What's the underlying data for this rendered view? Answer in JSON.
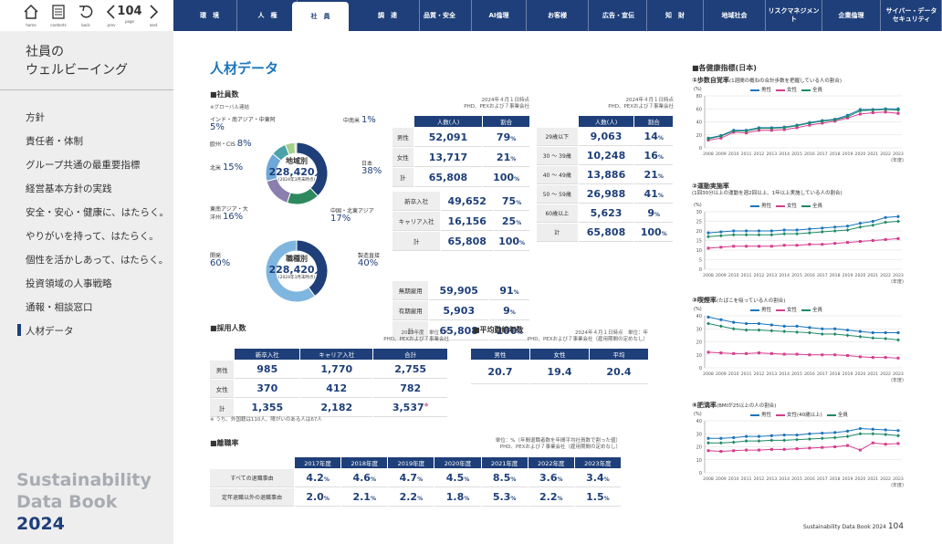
{
  "toolbar": {
    "home": "home",
    "contents": "contents",
    "back": "back",
    "prev": "prev",
    "page": "page",
    "next": "next",
    "page_number": "104"
  },
  "nav_tabs": [
    "環　境",
    "人　権",
    "社　員",
    "調　達",
    "品質・安全",
    "AI倫理",
    "お客様",
    "広告・宣伝",
    "知　財",
    "地域社会",
    "リスクマネジメント",
    "企業倫理",
    "サイバー・データ\nセキュリティ"
  ],
  "sidebar": {
    "title_line1": "社員の",
    "title_line2": "ウェルビーイング",
    "items": [
      "方針",
      "責任者・体制",
      "グループ共通の最重要指標",
      "経営基本方針の実践",
      "安全・安心・健康に、はたらく。",
      "やりがいを持って、はたらく。",
      "個性を活かしあって、はたらく。",
      "投資領域の人事戦略",
      "通報・相談窓口",
      "人材データ"
    ],
    "brand1": "Sustainability",
    "brand2": "Data Book",
    "brand3": "2024"
  },
  "colors": {
    "accent": "#1e3f79",
    "male": "#1a75bc",
    "female": "#d63c8e",
    "all": "#1f8a66"
  },
  "main": {
    "title": "人材データ",
    "employees": {
      "heading": "■社員数",
      "group_note": "※グローバル連結",
      "donut1": {
        "title": "地域別",
        "total": "228,420人",
        "sub": "(2024年3月末時点)",
        "labels": [
          {
            "name": "インド・南アジア・中東阿",
            "pct": "5%"
          },
          {
            "name": "欧州・CIS",
            "pct": "8%"
          },
          {
            "name": "北米",
            "pct": "15%"
          },
          {
            "name": "東南アジア・大洋州",
            "pct": "16%"
          },
          {
            "name": "中南米",
            "pct": "1%"
          },
          {
            "name": "日本",
            "pct": "38%"
          },
          {
            "name": "中国・北東アジア",
            "pct": "17%"
          }
        ]
      },
      "donut2": {
        "title": "職種別",
        "total": "228,420人",
        "sub": "(2024年3月末時点)",
        "labels": [
          {
            "name": "開発",
            "pct": "60%"
          },
          {
            "name": "製造直接",
            "pct": "40%"
          }
        ]
      },
      "note1a": "2024年４月１日時点",
      "note1b": "PHD、PEXおよび７事業会社",
      "note2a": "2024年４月１日時点",
      "note2b": "PHD、PEXおよび７事業会社",
      "gender_table": {
        "headers": [
          "人数(人)",
          "割合"
        ],
        "rows": [
          [
            "男性",
            "52,091",
            "79%"
          ],
          [
            "女性",
            "13,717",
            "21%"
          ],
          [
            "計",
            "65,808",
            "100%"
          ]
        ]
      },
      "hire_table": {
        "rows": [
          [
            "新卒入社",
            "49,652",
            "75%"
          ],
          [
            "キャリア入社",
            "16,156",
            "25%"
          ],
          [
            "計",
            "65,808",
            "100%"
          ]
        ]
      },
      "contract_table": {
        "rows": [
          [
            "無期雇用",
            "59,905",
            "91%"
          ],
          [
            "有期雇用",
            "5,903",
            "9%"
          ],
          [
            "計",
            "65,808",
            "100%"
          ]
        ]
      },
      "age_table": {
        "headers": [
          "人数(人)",
          "割合"
        ],
        "rows": [
          [
            "29歳以下",
            "9,063",
            "14%"
          ],
          [
            "30 ～ 39歳",
            "10,248",
            "16%"
          ],
          [
            "40 ～ 49歳",
            "13,886",
            "21%"
          ],
          [
            "50 ～ 59歳",
            "26,988",
            "41%"
          ],
          [
            "60歳以上",
            "5,623",
            "9%"
          ],
          [
            "計",
            "65,808",
            "100%"
          ]
        ]
      }
    },
    "recruit": {
      "heading": "■採用人数",
      "note_a": "2023年度　単位：人",
      "note_b": "PHD、PEXおよび７事業会社",
      "headers": [
        "新卒入社",
        "キャリア入社",
        "合計"
      ],
      "rows": [
        [
          "男性",
          "985",
          "1,770",
          "2,755"
        ],
        [
          "女性",
          "370",
          "412",
          "782"
        ],
        [
          "計",
          "1,355",
          "2,182",
          "3,537"
        ]
      ],
      "mark": "※",
      "footnote": "※ うち、外国籍は110人、障がいのある人は67人"
    },
    "tenure": {
      "heading": "■平均勤続年数",
      "note_a": "2024年４月１日時点　単位：年",
      "note_b": "PHD、PEXおよび７事業会社（雇用期間の定めなし）",
      "headers": [
        "男性",
        "女性",
        "平均"
      ],
      "values": [
        "20.7",
        "19.4",
        "20.4"
      ]
    },
    "turnover": {
      "heading": "■離職率",
      "note_a": "単位：%（年間退職者数を年間平均社員数で割った値）",
      "note_b": "PHD、PEXおよび７事業会社（雇用期間の定めなし）",
      "headers": [
        "2017年度",
        "2018年度",
        "2019年度",
        "2020年度",
        "2021年度",
        "2022年度",
        "2023年度"
      ],
      "rows": [
        {
          "label": "すべての退職事由",
          "values": [
            "4.2%",
            "4.6%",
            "4.7%",
            "4.5%",
            "8.5%",
            "3.6%",
            "3.4%"
          ]
        },
        {
          "label": "定年退職以外の退職事由",
          "values": [
            "2.0%",
            "2.1%",
            "2.2%",
            "1.8%",
            "5.3%",
            "2.2%",
            "1.5%"
          ]
        }
      ]
    }
  },
  "chart_data": [
    {
      "type": "line",
      "title": "①歩数自覚率",
      "subtitle": "(1週間の概ねの合計歩数を把握している人の割合)",
      "ylabel": "(%)",
      "xlabel": "(年度)",
      "ylim": [
        0,
        80
      ],
      "yticks": [
        0,
        20,
        40,
        60,
        80
      ],
      "x": [
        "2008",
        "2009",
        "2010",
        "2011",
        "2012",
        "2013",
        "2014",
        "2015",
        "2016",
        "2017",
        "2018",
        "2019",
        "2020",
        "2021",
        "2022",
        "2023"
      ],
      "series": [
        {
          "name": "男性",
          "values": [
            15,
            19,
            27,
            27,
            31,
            31,
            32,
            35,
            39,
            42,
            44,
            50,
            59,
            59,
            60,
            60
          ]
        },
        {
          "name": "女性",
          "values": [
            12,
            15,
            24,
            23,
            27,
            27,
            28,
            31,
            35,
            38,
            41,
            46,
            52,
            54,
            55,
            53
          ]
        },
        {
          "name": "全員",
          "values": [
            14,
            18,
            26,
            26,
            30,
            30,
            31,
            34,
            38,
            41,
            43,
            48,
            57,
            58,
            59,
            58
          ]
        }
      ]
    },
    {
      "type": "line",
      "title": "②運動実施率",
      "subtitle": "(1回30分以上の運動を週2回以上、1年以上実施している人の割合)",
      "ylabel": "(%)",
      "xlabel": "(年度)",
      "ylim": [
        0,
        30
      ],
      "yticks": [
        0,
        5,
        10,
        15,
        20,
        25,
        30
      ],
      "x": [
        "2008",
        "2009",
        "2010",
        "2011",
        "2012",
        "2013",
        "2014",
        "2015",
        "2016",
        "2017",
        "2018",
        "2019",
        "2020",
        "2021",
        "2022",
        "2023"
      ],
      "series": [
        {
          "name": "男性",
          "values": [
            19,
            19.5,
            20,
            20,
            20,
            20,
            20.5,
            20.5,
            21,
            21.5,
            22,
            22.5,
            24,
            25,
            27,
            27.5
          ]
        },
        {
          "name": "女性",
          "values": [
            11,
            11.5,
            12,
            12,
            12,
            12,
            12.5,
            12.5,
            13,
            13,
            13.5,
            14,
            14.5,
            15,
            15.5,
            16
          ]
        },
        {
          "name": "全員",
          "values": [
            17,
            17.5,
            18,
            18,
            18,
            18,
            18.5,
            18.5,
            19,
            19.5,
            20,
            20.5,
            22,
            23,
            24.5,
            25
          ]
        }
      ]
    },
    {
      "type": "line",
      "title": "③喫煙率",
      "subtitle": "(たばこを吸っている人の割合)",
      "ylabel": "(%)",
      "xlabel": "(年度)",
      "ylim": [
        0,
        40
      ],
      "yticks": [
        0,
        10,
        20,
        30,
        40
      ],
      "x": [
        "2008",
        "2009",
        "2010",
        "2011",
        "2012",
        "2013",
        "2014",
        "2015",
        "2016",
        "2017",
        "2018",
        "2019",
        "2020",
        "2021",
        "2022",
        "2023"
      ],
      "series": [
        {
          "name": "男性",
          "values": [
            39,
            37,
            35,
            34,
            34,
            33,
            32,
            32,
            31,
            30,
            30,
            29,
            28,
            27,
            27,
            27
          ]
        },
        {
          "name": "女性",
          "values": [
            12,
            11.5,
            11,
            11,
            11.5,
            11,
            10.5,
            10.5,
            10,
            10,
            10,
            9.5,
            8.5,
            8,
            8,
            7.5
          ]
        },
        {
          "name": "全員",
          "values": [
            34,
            32,
            30,
            29,
            29,
            28.5,
            28,
            27.5,
            27,
            26,
            26,
            25,
            24,
            23,
            22.5,
            21.5
          ]
        }
      ]
    },
    {
      "type": "line",
      "title": "④肥満率",
      "subtitle": "(BMIが25以上の人の割合)",
      "ylabel": "(%)",
      "xlabel": "(年度)",
      "ylim": [
        0,
        40
      ],
      "yticks": [
        0,
        10,
        20,
        30,
        40
      ],
      "x": [
        "2008",
        "2009",
        "2010",
        "2011",
        "2012",
        "2013",
        "2014",
        "2015",
        "2016",
        "2017",
        "2018",
        "2019",
        "2020",
        "2021",
        "2022",
        "2023"
      ],
      "series": [
        {
          "name": "男性",
          "values": [
            26.5,
            26.5,
            27,
            28,
            28,
            28.5,
            29,
            29,
            30,
            30.5,
            31,
            32,
            34,
            33.5,
            33,
            32.5
          ]
        },
        {
          "name": "女性(40歳以上)",
          "values": [
            17,
            16.5,
            17,
            17.5,
            17.5,
            18,
            18,
            18.5,
            19,
            19.5,
            20,
            21,
            17.5,
            23,
            22,
            22.5
          ]
        },
        {
          "name": "全員",
          "values": [
            23,
            23,
            23.5,
            24.5,
            24.5,
            25,
            25,
            25.5,
            26,
            26.5,
            27,
            28,
            30,
            30,
            29.5,
            28.5
          ]
        }
      ]
    }
  ],
  "health": {
    "heading": "■各健康指標(日本)"
  },
  "footer": {
    "text": "Sustainability Data Book 2024",
    "page": "104"
  }
}
